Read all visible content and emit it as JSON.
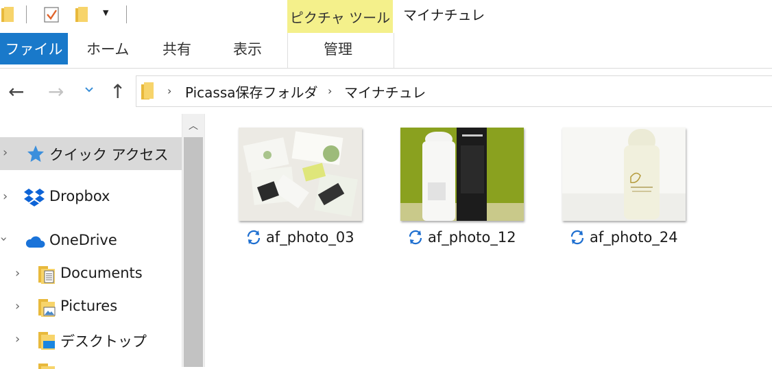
{
  "title_bar": {
    "context_tab": "ピクチャ ツール",
    "window_title": "マイナチュレ"
  },
  "ribbon": {
    "file_tab": "ファイル",
    "tabs": [
      "ホーム",
      "共有",
      "表示"
    ],
    "context_subtab": "管理"
  },
  "address_bar": {
    "breadcrumbs": [
      "Picassa保存フォルダ",
      "マイナチュレ"
    ]
  },
  "nav_pane": {
    "items": [
      {
        "label": "クイック アクセス",
        "icon": "star-icon",
        "expanded": false,
        "selected": true
      },
      {
        "label": "Dropbox",
        "icon": "dropbox-icon",
        "expanded": false,
        "selected": false
      },
      {
        "label": "OneDrive",
        "icon": "cloud-icon",
        "expanded": true,
        "selected": false
      },
      {
        "label": "Documents",
        "icon": "documents-folder-icon",
        "expanded": false,
        "selected": false
      },
      {
        "label": "Pictures",
        "icon": "pictures-folder-icon",
        "expanded": false,
        "selected": false
      },
      {
        "label": "デスクトップ",
        "icon": "desktop-folder-icon",
        "expanded": false,
        "selected": false
      }
    ]
  },
  "files": [
    {
      "name": "af_photo_03",
      "status_icon": "sync-icon"
    },
    {
      "name": "af_photo_12",
      "status_icon": "sync-icon"
    },
    {
      "name": "af_photo_24",
      "status_icon": "sync-icon"
    }
  ],
  "colors": {
    "file_tab": "#1979ca",
    "context_tab": "#f4f08b",
    "selection": "#d9d9d9",
    "sync_blue": "#1e6fd0"
  }
}
